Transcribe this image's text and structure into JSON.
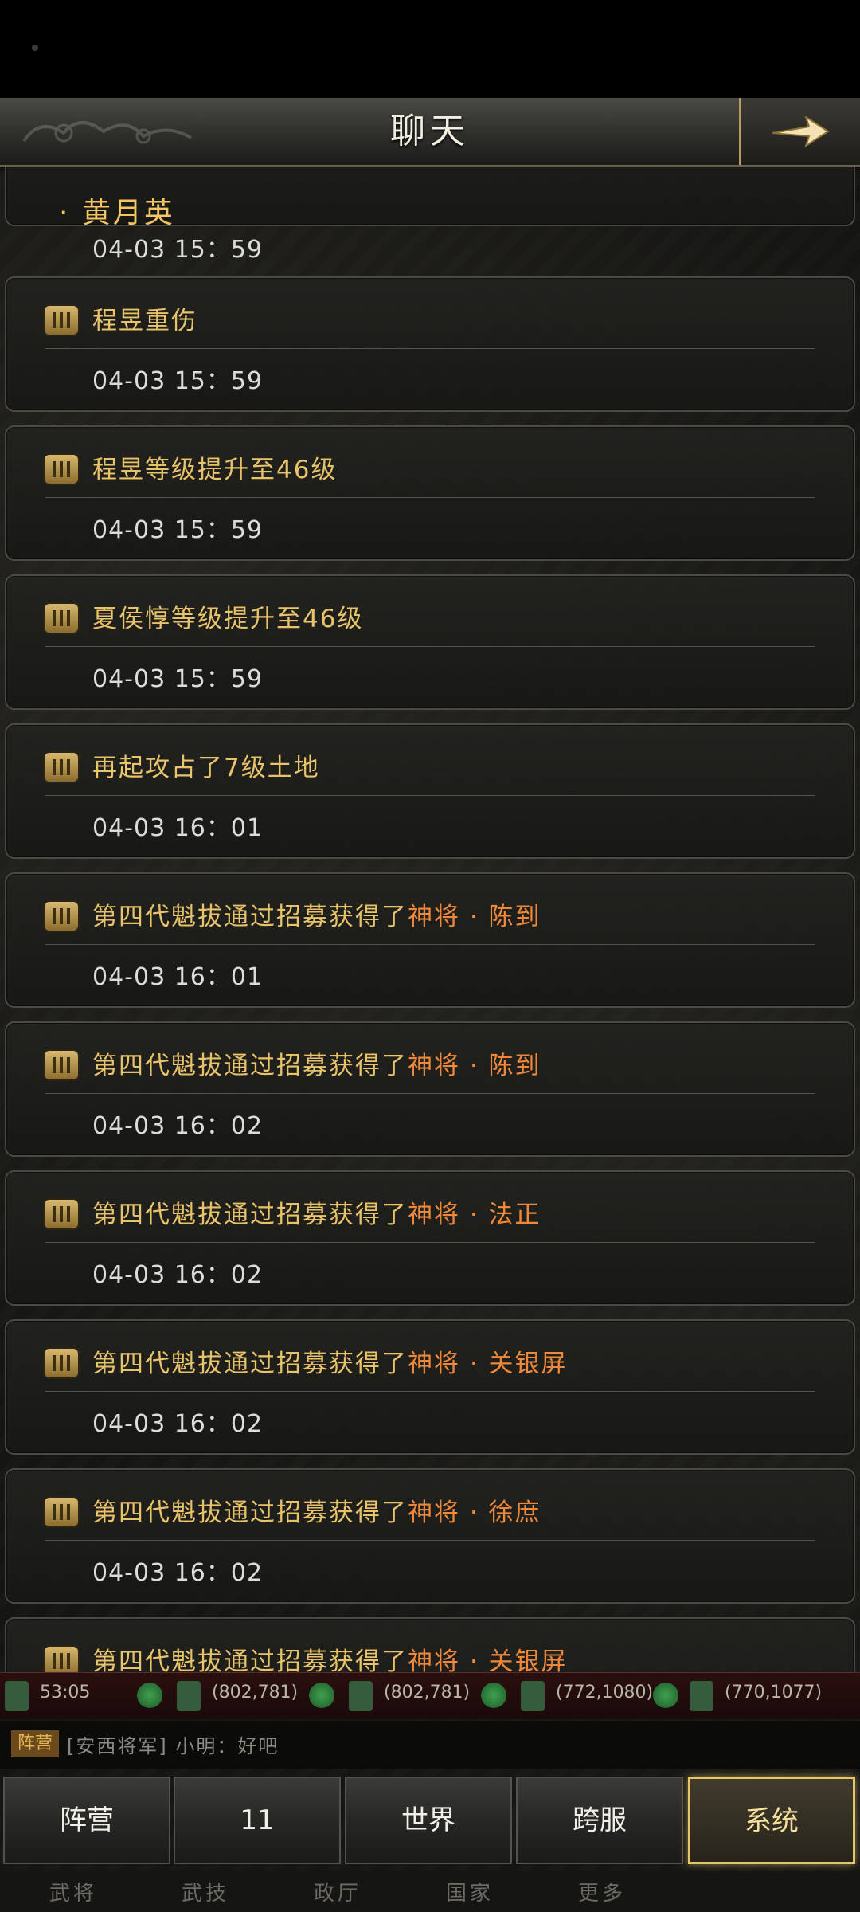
{
  "header": {
    "title": "聊天",
    "back_icon": "arrow-right-icon"
  },
  "first_card": {
    "name": "· 黄月英",
    "time": "04-03 15：59"
  },
  "messages": [
    {
      "text": "程昱重伤",
      "highlight": "",
      "time": "04-03 15：59"
    },
    {
      "text": "程昱等级提升至46级",
      "highlight": "",
      "time": "04-03 15：59"
    },
    {
      "text": "夏侯惇等级提升至46级",
      "highlight": "",
      "time": "04-03 15：59"
    },
    {
      "text": "再起攻占了7级土地",
      "highlight": "",
      "time": "04-03 16：01"
    },
    {
      "text": "第四代魁拔通过招募获得了",
      "highlight": "神将 · 陈到",
      "time": "04-03 16：01"
    },
    {
      "text": "第四代魁拔通过招募获得了",
      "highlight": "神将 · 陈到",
      "time": "04-03 16：02"
    },
    {
      "text": "第四代魁拔通过招募获得了",
      "highlight": "神将 · 法正",
      "time": "04-03 16：02"
    },
    {
      "text": "第四代魁拔通过招募获得了",
      "highlight": "神将 · 关银屏",
      "time": "04-03 16：02"
    },
    {
      "text": "第四代魁拔通过招募获得了",
      "highlight": "神将 · 徐庶",
      "time": "04-03 16：02"
    },
    {
      "text": "第四代魁拔通过招募获得了",
      "highlight": "神将 · 关银屏",
      "time": ""
    }
  ],
  "resources": [
    {
      "value": "53:05"
    },
    {
      "value": "(802,781)"
    },
    {
      "value": "(802,781)"
    },
    {
      "value": "(772,1080)"
    },
    {
      "value": "(770,1077)"
    }
  ],
  "ticker": {
    "badge": "阵营",
    "text": "[安西将军] 小明：好吧"
  },
  "tabs": [
    {
      "label": "阵营"
    },
    {
      "label": "11"
    },
    {
      "label": "世界"
    },
    {
      "label": "跨服"
    },
    {
      "label": "系统",
      "active": true
    }
  ],
  "bottom_nav": [
    "武将",
    "武技",
    "政厅",
    "国家",
    "更多"
  ],
  "colors": {
    "accent_gold": "#e9c36a",
    "highlight_orange": "#f0883a",
    "active_border": "#e4c66d"
  }
}
